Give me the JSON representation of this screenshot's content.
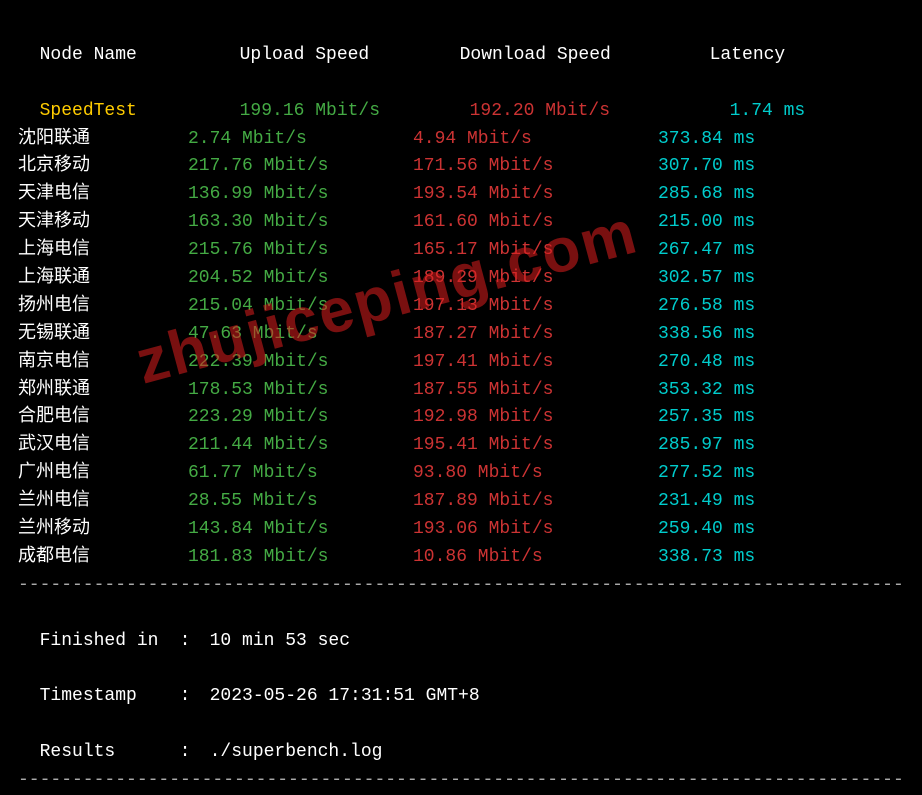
{
  "header": {
    "node": "Node Name",
    "upload": "Upload Speed",
    "download": "Download Speed",
    "latency": "Latency"
  },
  "speedtest": {
    "name": "SpeedTest",
    "upload": "199.16 Mbit/s",
    "download": "192.20 Mbit/s",
    "latency": "1.74 ms"
  },
  "rows": [
    {
      "name": "沈阳联通",
      "upload": "2.74 Mbit/s",
      "download": "4.94 Mbit/s",
      "latency": "373.84 ms"
    },
    {
      "name": "北京移动",
      "upload": "217.76 Mbit/s",
      "download": "171.56 Mbit/s",
      "latency": "307.70 ms"
    },
    {
      "name": "天津电信",
      "upload": "136.99 Mbit/s",
      "download": "193.54 Mbit/s",
      "latency": "285.68 ms"
    },
    {
      "name": "天津移动",
      "upload": "163.30 Mbit/s",
      "download": "161.60 Mbit/s",
      "latency": "215.00 ms"
    },
    {
      "name": "上海电信",
      "upload": "215.76 Mbit/s",
      "download": "165.17 Mbit/s",
      "latency": "267.47 ms"
    },
    {
      "name": "上海联通",
      "upload": "204.52 Mbit/s",
      "download": "189.29 Mbit/s",
      "latency": "302.57 ms"
    },
    {
      "name": "扬州电信",
      "upload": "215.04 Mbit/s",
      "download": "197.13 Mbit/s",
      "latency": "276.58 ms"
    },
    {
      "name": "无锡联通",
      "upload": "47.63 Mbit/s",
      "download": "187.27 Mbit/s",
      "latency": "338.56 ms"
    },
    {
      "name": "南京电信",
      "upload": "222.39 Mbit/s",
      "download": "197.41 Mbit/s",
      "latency": "270.48 ms"
    },
    {
      "name": "郑州联通",
      "upload": "178.53 Mbit/s",
      "download": "187.55 Mbit/s",
      "latency": "353.32 ms"
    },
    {
      "name": "合肥电信",
      "upload": "223.29 Mbit/s",
      "download": "192.98 Mbit/s",
      "latency": "257.35 ms"
    },
    {
      "name": "武汉电信",
      "upload": "211.44 Mbit/s",
      "download": "195.41 Mbit/s",
      "latency": "285.97 ms"
    },
    {
      "name": "广州电信",
      "upload": "61.77 Mbit/s",
      "download": "93.80 Mbit/s",
      "latency": "277.52 ms"
    },
    {
      "name": "兰州电信",
      "upload": "28.55 Mbit/s",
      "download": "187.89 Mbit/s",
      "latency": "231.49 ms"
    },
    {
      "name": "兰州移动",
      "upload": "143.84 Mbit/s",
      "download": "193.06 Mbit/s",
      "latency": "259.40 ms"
    },
    {
      "name": "成都电信",
      "upload": "181.83 Mbit/s",
      "download": "10.86 Mbit/s",
      "latency": "338.73 ms"
    }
  ],
  "footer": {
    "finished_label": "Finished in",
    "finished_value": "10 min 53 sec",
    "timestamp_label": "Timestamp",
    "timestamp_value": "2023-05-26 17:31:51 GMT+8",
    "results_label": "Results",
    "results_value": "./superbench.log",
    "sep": ":"
  },
  "watermark": "zhujiceping.com",
  "divider": "----------------------------------------------------------------------------------"
}
